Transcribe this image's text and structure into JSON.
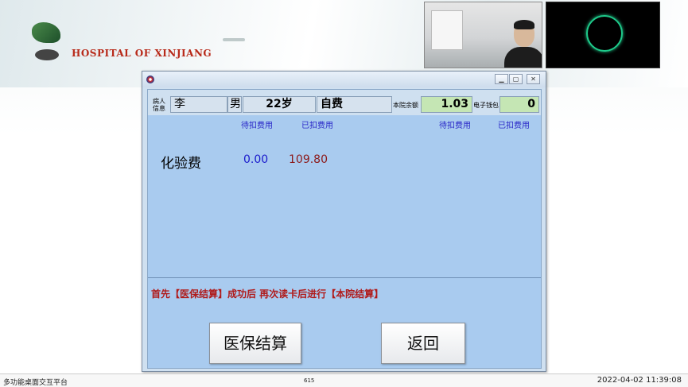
{
  "desktop": {
    "hospital_name": "HOSPITAL OF XINJIANG"
  },
  "dialog": {
    "patient_label": "病人\n信息",
    "patient_name": "李",
    "gender": "男",
    "age": "22岁",
    "payment_type": "自费",
    "hospital_balance_label": "本院余额",
    "hospital_balance": "1.03",
    "ewallet_label": "电子钱包",
    "ewallet_balance": "0",
    "columns": {
      "pending_left": "待扣费用",
      "paid_left": "已扣费用",
      "pending_right": "待扣费用",
      "paid_right": "已扣费用"
    },
    "fees": [
      {
        "name": "化验费",
        "pending": "0.00",
        "paid": "109.80"
      }
    ],
    "notice": "首先【医保结算】成功后 再次读卡后进行【本院结算】",
    "insurance_button": "医保结算",
    "back_button": "返回"
  },
  "taskbar": {
    "app_name": "多功能桌面交互平台",
    "center_text": "615",
    "datetime": "2022-04-02 11:39:08"
  }
}
